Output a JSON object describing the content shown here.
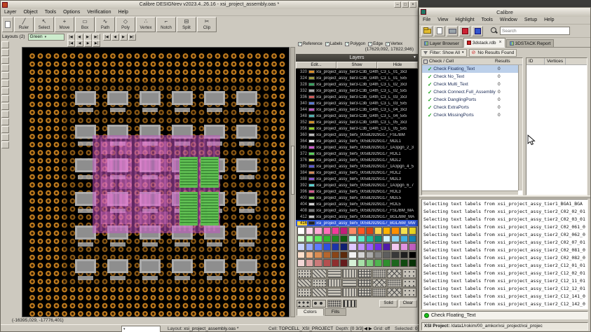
{
  "colors": {
    "ball": "#c07c1e",
    "ball_core": "#2a1602",
    "die": "#b4b4b4",
    "die_inner": "#8e8e8e",
    "purple": "#c44fc4",
    "pink": "#ff8adf",
    "green": "#5dc44f",
    "green_line": "#1c5c1c",
    "selection": "#2f55d4",
    "check_green": "#13a113",
    "status_dot": "#18c018"
  },
  "left_window": {
    "title": "Calibre DESIGNrev v2023.4..26.16  -  xsi_project_assembly.oas *",
    "menus": [
      "Layer",
      "Object",
      "Tools",
      "Options",
      "Verification",
      "Help"
    ],
    "tools": [
      {
        "label": "Ruler",
        "icon": "╱"
      },
      {
        "label": "Select",
        "icon": "↖"
      },
      {
        "label": "Move",
        "icon": "+"
      },
      {
        "label": "Box",
        "icon": "▭"
      },
      {
        "label": "Path",
        "icon": "∿"
      },
      {
        "label": "Poly",
        "icon": "◇"
      },
      {
        "label": "Vertex",
        "icon": "∴"
      },
      {
        "label": "Notch",
        "icon": "⌐"
      },
      {
        "label": "Split",
        "icon": "⊟"
      },
      {
        "label": "Clip",
        "icon": "✂"
      }
    ],
    "layouts_label": "Layouts (2)",
    "layouts_value": "Green",
    "nav_buttons": [
      "|◀",
      "◀",
      "▶",
      "▶|"
    ],
    "view_checks": [
      "Reference",
      "Labels",
      "Polygon",
      "Edge",
      "Vertex"
    ],
    "coord_top": "(17629,092, 17822,946)",
    "coord_bottom": "(-16395,029, -17776,401)",
    "statusbar": {
      "layout_label": "Layout:",
      "layout_value": "xsi_project_assembly.oas *",
      "cell_label": "Cell:",
      "cell_value": "TOPCELL_XSI_PROJECT",
      "depth_label": "Depth:",
      "depth_value": "[0 3/3]",
      "nav_glyphs": "◀ ▶",
      "grid_label": "Grid:",
      "grid_value": "off",
      "selected_label": "Selected:",
      "selected_value": "0"
    }
  },
  "layers_panel": {
    "title": "Layers",
    "dropdown_glyph": "▾",
    "columns": [
      "Edit...",
      "Show",
      "Hide"
    ],
    "rows": [
      {
        "num": "320",
        "color": "#d98e2b",
        "name": "xsi_project_assy_tier3-C3b_G4th_C3_L_01_3x3"
      },
      {
        "num": "324",
        "color": "#9a9a40",
        "name": "xsi_project_assy_tier3-C3b_G4th_C3_L_01_5x5"
      },
      {
        "num": "328",
        "color": "#37a05f",
        "name": "xsi_project_assy_tier3-C3b_G4th_C3_L_02_3x3"
      },
      {
        "num": "332",
        "color": "#a9a9a9",
        "name": "xsi_project_assy_tier3-C3b_G4th_C3_L_02_5x5"
      },
      {
        "num": "336",
        "color": "#d05a5a",
        "name": "xsi_project_assy_tier3-C3b_G4th_C3_L_03_3x3"
      },
      {
        "num": "340",
        "color": "#5a7ad0",
        "name": "xsi_project_assy_tier3-C3b_G4th_C3_L_03_5x5"
      },
      {
        "num": "344",
        "color": "#c05ac0",
        "name": "xsi_project_assy_tier3-C3b_G4th_C3_L_04_3x3"
      },
      {
        "num": "348",
        "color": "#50b0b0",
        "name": "xsi_project_assy_tier3-C3b_G4th_C3_L_04_5x5"
      },
      {
        "num": "352",
        "color": "#d0902a",
        "name": "xsi_project_assy_tier3-C3b_G4th_C3_L_05_3x3"
      },
      {
        "num": "356",
        "color": "#90d02a",
        "name": "xsi_project_assy_tier3-C3b_G4th_C3_L_05_5x5"
      },
      {
        "num": "360",
        "color": "#b8b8b8",
        "name": "xsi_project_assy_tier5_0058D929G17_FSL/BM"
      },
      {
        "num": "364",
        "color": "#e8e8e8",
        "name": "xsi_project_assy_tier5_0058D929G17_MDL1"
      },
      {
        "num": "368",
        "color": "#d05ad0",
        "name": "xsi_project_assy_tier5_0058D929G17_1A3pgn_2_3"
      },
      {
        "num": "372",
        "color": "#5ad05a",
        "name": "xsi_project_assy_tier5_0058D929G17_ROL1"
      },
      {
        "num": "376",
        "color": "#d0d05a",
        "name": "xsi_project_assy_tier5_0058D929G17_MDL2"
      },
      {
        "num": "380",
        "color": "#5a5ad0",
        "name": "xsi_project_assy_tier5_0058D929G17_1A3pgn_4_5"
      },
      {
        "num": "384",
        "color": "#d08a5a",
        "name": "xsi_project_assy_tier5_0058D929G17_ROL2"
      },
      {
        "num": "388",
        "color": "#8a5ad0",
        "name": "xsi_project_assy_tier5_0058D929G17_MDL3"
      },
      {
        "num": "392",
        "color": "#5ad0d0",
        "name": "xsi_project_assy_tier5_0058D929G17_1A3pgn_6_7"
      },
      {
        "num": "396",
        "color": "#d05a8a",
        "name": "xsi_project_assy_tier5_0058D929G17_ROL3"
      },
      {
        "num": "400",
        "color": "#8ad05a",
        "name": "xsi_project_assy_tier5_0058D929G17_MDL5"
      },
      {
        "num": "404",
        "color": "#d0d0d0",
        "name": "xsi_project_assy_tier5_0058D929G17_ROL5"
      },
      {
        "num": "408",
        "color": "#787878",
        "name": "xsi_project_assy_tier5_0058D929G17_FSL/BM_MA"
      },
      {
        "num": "412",
        "color": "#c0c0c0",
        "name": "xsi_project_assy_tier5_0058D929G17_BGL/BM_MA"
      },
      {
        "num": "416",
        "color": "#202020",
        "name": "xsi_project_assy_tier5_0058D929G17_BGL/BM_MW",
        "selected": true
      }
    ],
    "palette": [
      [
        "#ffffff",
        "#ffd9ec",
        "#ffaad5",
        "#ff6fba",
        "#f23a9a",
        "#c21e7a",
        "#ff8a65",
        "#ff5722",
        "#d84315",
        "#ffd54f",
        "#ffb300",
        "#ff8f00",
        "#f4e04d",
        "#e8d420"
      ],
      [
        "#d7ffd7",
        "#9fff9f",
        "#5ee85e",
        "#2eb82e",
        "#1f8a1f",
        "#0f5c0f",
        "#b2ffe5",
        "#5ce8c4",
        "#1fbf9a",
        "#0e8a70",
        "#d2f2ff",
        "#8ad5f2",
        "#3fb0e0",
        "#1580b0"
      ],
      [
        "#c8d4ff",
        "#93a8ff",
        "#5e7bff",
        "#2e4fe0",
        "#1c33a8",
        "#101f70",
        "#e0c8ff",
        "#bf93ff",
        "#995eff",
        "#6f2ee0",
        "#4f1ca8",
        "#f2c8f2",
        "#e093e0",
        "#c05ec0"
      ],
      [
        "#ffe0cc",
        "#f2b68a",
        "#d98c52",
        "#b5662e",
        "#8a4518",
        "#5c2a0c",
        "#f2f2f2",
        "#d4d4d4",
        "#ababab",
        "#858585",
        "#5e5e5e",
        "#383838",
        "#1f1f1f",
        "#000000"
      ],
      [
        "#f2d7d7",
        "#e0a8a8",
        "#cc7a7a",
        "#b54f4f",
        "#8f2e2e",
        "#661c1c",
        "#d7f2d7",
        "#a8e0a8",
        "#7acc7a",
        "#4fb54f",
        "#2e8f2e",
        "#1c661c",
        "#0f4a0f",
        "#073307"
      ]
    ],
    "patterns": [
      "dots",
      "diag",
      "horiz",
      "vert",
      "grid",
      "dense",
      "cross",
      "sparse",
      "diag",
      "dots",
      "vert",
      "horiz",
      "grid",
      "cross",
      "dense",
      "sparse",
      "dots",
      "diag",
      "horiz",
      "vert",
      "grid",
      "dense",
      "cross",
      "sparse"
    ],
    "special_patterns": [
      "via",
      "ball",
      "array",
      "pad"
    ],
    "buttons": [
      "Solid",
      "Clear"
    ],
    "tabs": [
      "Colors",
      "Fills"
    ]
  },
  "right_window": {
    "title": "Calibre",
    "menus": [
      "File",
      "View",
      "Highlight",
      "Tools",
      "Window",
      "Setup",
      "Help"
    ],
    "search_placeholder": "Search",
    "tabs": [
      {
        "label": "Layer Browser",
        "active": false
      },
      {
        "label": "3dstack.rdb",
        "active": true,
        "closable": true
      },
      {
        "label": "3DSTACK Report",
        "active": false
      }
    ],
    "tab_close_glyph": "×",
    "filter_label": "Filter: Show All",
    "no_results_glyph": "⊘",
    "no_results": "No Results Found",
    "tree_header": "Check / Cell",
    "results_header": "Results",
    "checks": [
      {
        "name": "Check Floating_Text",
        "results": "0",
        "selected": true
      },
      {
        "name": "Check No_Text",
        "results": "0"
      },
      {
        "name": "Check Multi_Text",
        "results": "0"
      },
      {
        "name": "Check Connect.Full_Assembly",
        "results": "0"
      },
      {
        "name": "Check DanglingPorts",
        "results": "0"
      },
      {
        "name": "Check ExtraPorts",
        "results": "0"
      },
      {
        "name": "Check MissingPorts",
        "results": "0"
      }
    ],
    "table_columns": [
      "ID",
      "Vertices"
    ],
    "log_prefix": "Selecting text labels from ",
    "log_lines": [
      "xsi_project_assy_tier1_BGA1_BGA",
      "xsi_project_assy_tier2_C02_02_01",
      "xsi_project_assy_tier2_C02_03_01",
      "xsi_project_assy_tier2_C02_061_0",
      "xsi_project_assy_tier2_C02_062_0",
      "xsi_project_assy_tier2_C02_07_01",
      "xsi_project_assy_tier2_C02_081_0",
      "xsi_project_assy_tier2_C02_082_0",
      "xsi_project_assy_tier2_C12_01_01",
      "xsi_project_assy_tier2_C12_02_01",
      "xsi_project_assy_tier2_C12_11_01",
      "xsi_project_assy_tier2_C12_12_01",
      "xsi_project_assy_tier2_C12_141_0",
      "xsi_project_assy_tier2_C12_142_0"
    ],
    "status_check": "Check Floating_Text",
    "project_label": "XSI Project:",
    "project_path": "/data1/rokim/00_amkor/xsi_project/xsi_projec"
  }
}
